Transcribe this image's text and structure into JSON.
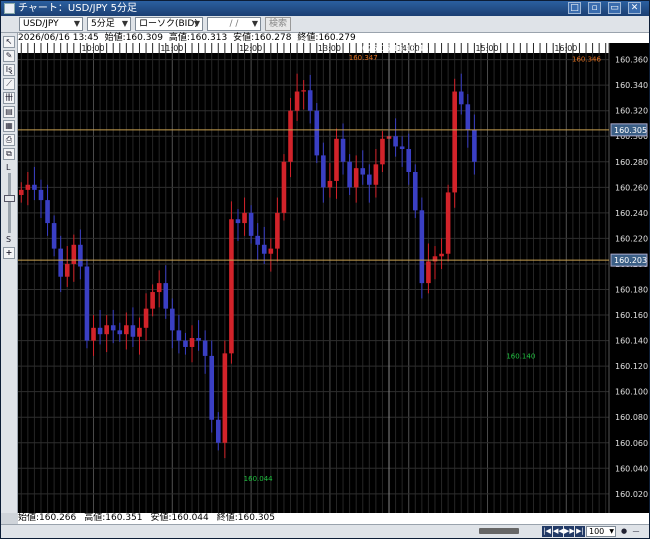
{
  "window": {
    "title": "チャート：USD/JPY 5分足",
    "buttons": [
      "□",
      "▫",
      "▭",
      "✕"
    ]
  },
  "toolbar": {
    "symbol": "USD/JPY",
    "timeframe": "5分足",
    "chart_type": "ローソク(BID)",
    "date_placeholder": "/ /",
    "search_label": "検索"
  },
  "info": {
    "datetime": "2026/06/16 13:45",
    "open": "始値:160.309",
    "high": "高値:160.313",
    "low": "安値:160.278",
    "close": "終値:160.279"
  },
  "summary": {
    "open": "始値:160.266",
    "high": "高値:160.351",
    "low": "安値:160.044",
    "close": "終値:160.305"
  },
  "zoom": "100",
  "left_tools": [
    "↖",
    "✎",
    "Iȿ",
    "⟋",
    "卌",
    "▤",
    "▦",
    "⎙",
    "⧉"
  ],
  "slider_top_label": "L",
  "slider_bottom_label": "S",
  "colors": {
    "up": "#d2232a",
    "down": "#3a3fc4",
    "hline": "#c8a050",
    "grid": "#3a3a3a",
    "text": "#e0e0e0",
    "high_label": "#e07020",
    "low_label": "#20c040"
  },
  "chart_data": {
    "type": "candlestick",
    "symbol": "USD/JPY",
    "timeframe": "5min",
    "x_tick_labels": [
      "10:00",
      "11:00",
      "12:00",
      "13:00",
      "14:00",
      "15:00",
      "16:00"
    ],
    "x_tick_bar_index": [
      11,
      23,
      35,
      47,
      59,
      71,
      83
    ],
    "crosshair_label": "2026/06/16 13:45",
    "crosshair_bar_index": 56,
    "y_tick_labels": [
      "160.020",
      "160.040",
      "160.060",
      "160.080",
      "160.100",
      "160.120",
      "160.140",
      "160.160",
      "160.180",
      "160.200",
      "160.220",
      "160.240",
      "160.260",
      "160.280",
      "160.300",
      "160.320",
      "160.340",
      "160.360"
    ],
    "ylim": [
      160.005,
      160.373
    ],
    "price_labels": [
      {
        "value": 160.305,
        "text": "160.305"
      },
      {
        "value": 160.203,
        "text": "160.203"
      }
    ],
    "horizontal_lines": [
      160.305,
      160.203
    ],
    "annotations": [
      {
        "text": "160.347",
        "bar_index": 52,
        "value": 160.347,
        "kind": "high"
      },
      {
        "text": "160.346",
        "bar_index": 86,
        "value": 160.346,
        "kind": "high"
      },
      {
        "text": "160.140",
        "bar_index": 76,
        "value": 160.14,
        "kind": "low"
      },
      {
        "text": "160.044",
        "bar_index": 36,
        "value": 160.044,
        "kind": "low"
      }
    ],
    "closes": [
      160.258,
      160.262,
      160.258,
      160.25,
      160.232,
      160.212,
      160.19,
      160.2,
      160.215,
      160.198,
      160.14,
      160.15,
      160.145,
      160.152,
      160.148,
      160.145,
      160.152,
      160.143,
      160.15,
      160.165,
      160.178,
      160.185,
      160.165,
      160.148,
      160.14,
      160.135,
      160.142,
      160.14,
      160.128,
      160.078,
      160.06,
      160.13,
      160.235,
      160.232,
      160.24,
      160.222,
      160.215,
      160.208,
      160.212,
      160.24,
      160.28,
      160.32,
      160.335,
      160.336,
      160.32,
      160.285,
      160.26,
      160.265,
      160.298,
      160.28,
      160.26,
      160.275,
      160.27,
      160.262,
      160.278,
      160.298,
      160.3,
      160.292,
      160.29,
      160.272,
      160.242,
      160.185,
      160.202,
      160.206,
      160.208,
      160.256,
      160.335,
      160.325,
      160.305,
      160.28
    ],
    "bar_count": 90
  }
}
